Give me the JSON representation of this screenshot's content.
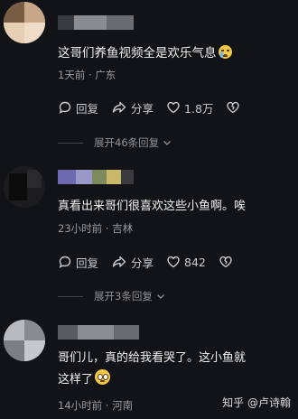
{
  "comments": [
    {
      "text": "这哥们养鱼视频全是欢乐气息",
      "emoji": "crying-face",
      "meta": "1天前 · 广东",
      "reply": "回复",
      "share": "分享",
      "likes": "1.8万",
      "expand": "展开46条回复"
    },
    {
      "text": "真看出来哥们很喜欢这些小鱼啊。唉",
      "meta": "23小时前 · 吉林",
      "reply": "回复",
      "share": "分享",
      "likes": "842",
      "expand": "展开3条回复"
    },
    {
      "text_line1": "哥们儿，真的给我看哭了。这小鱼就",
      "text_line2": "这样了",
      "emoji": "pleading-face",
      "meta": "14小时前 · 河南"
    }
  ],
  "watermark": "知乎 @卢诗翰",
  "colors": {
    "background": "#121317",
    "text": "#f1f1f3",
    "muted": "#9a9ba1"
  }
}
